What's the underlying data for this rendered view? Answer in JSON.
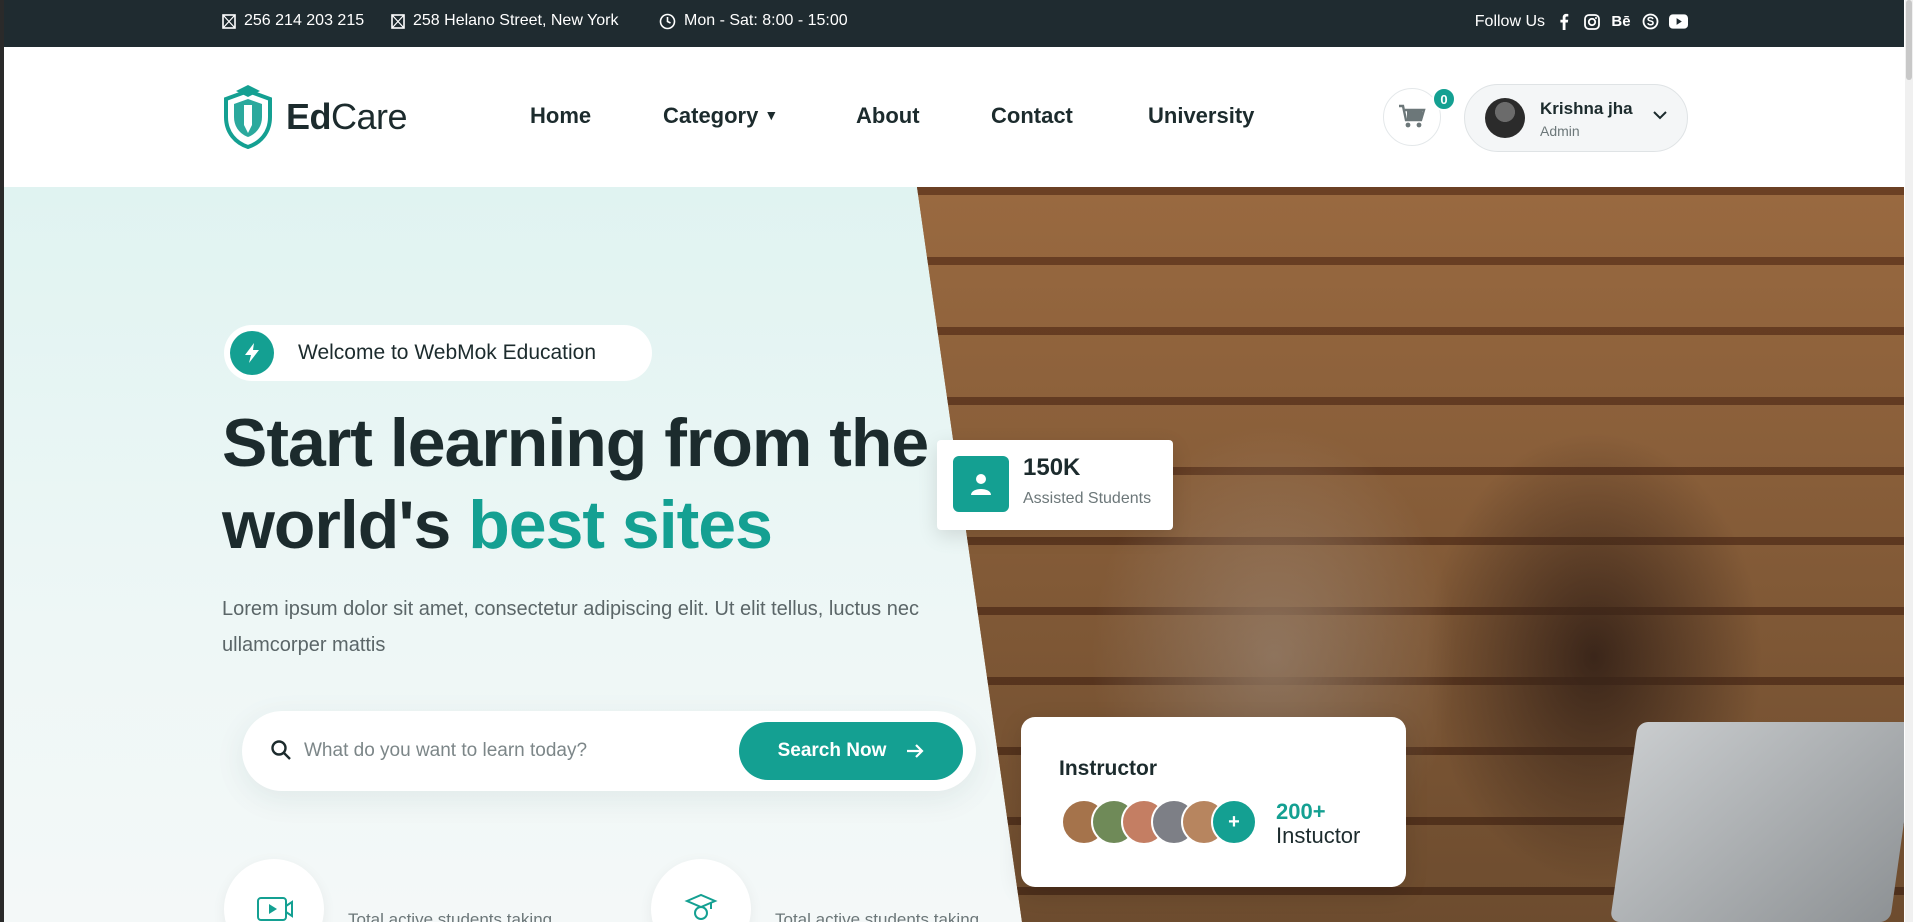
{
  "topbar": {
    "phone": "256 214 203 215",
    "address": "258 Helano Street, New York",
    "hours": "Mon - Sat: 8:00 - 15:00",
    "follow_label": "Follow Us",
    "social_icons": [
      "facebook-icon",
      "instagram-icon",
      "behance-icon",
      "skype-icon",
      "youtube-icon"
    ]
  },
  "header": {
    "logo": {
      "text_bold": "Ed",
      "text_regular": "Care"
    },
    "nav": [
      "Home",
      "Category",
      "About",
      "Contact",
      "University"
    ],
    "cart_count": "0",
    "user": {
      "name": "Krishna jha",
      "role": "Admin"
    }
  },
  "hero": {
    "badge": "Welcome to WebMok Education",
    "title_line1": "Start learning from the",
    "title_line2_plain": "world's",
    "title_line2_accent": "best sites",
    "lead": "Lorem ipsum dolor sit amet, consectetur adipiscing elit. Ut elit tellus, luctus nec ullamcorper mattis",
    "search": {
      "placeholder": "What do you want to learn today?",
      "button": "Search Now"
    },
    "stat": {
      "value": "150K",
      "label": "Assisted Students"
    },
    "instructor": {
      "title": "Instructor",
      "plus": "+",
      "count": "200+",
      "label": "Instuctor"
    },
    "features": [
      {
        "icon": "video-lesson-icon",
        "text": "Total active students taking"
      },
      {
        "icon": "graduate-icon",
        "text": "Total active students taking"
      }
    ]
  },
  "colors": {
    "accent": "#14a092",
    "topbar_bg": "#1f2b30",
    "text_dark": "#1c2b2d",
    "hero_bg": "#e0f3f1"
  }
}
